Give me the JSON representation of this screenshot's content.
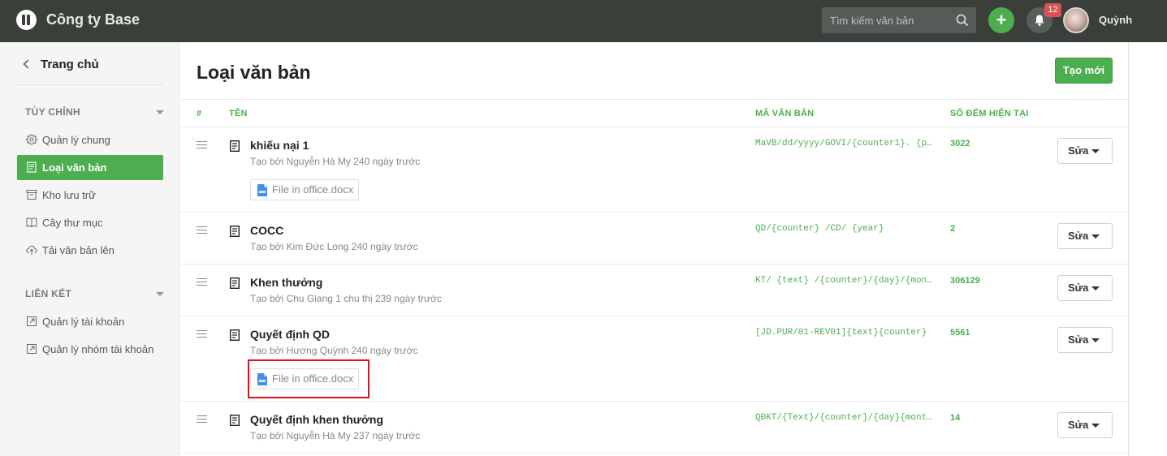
{
  "header": {
    "brand": "Công ty Base",
    "search_placeholder": "Tìm kiếm văn bản",
    "add_label": "+",
    "notification_count": "12",
    "username": "Quỳnh"
  },
  "sidebar": {
    "home": "Trang chủ",
    "sections": [
      {
        "title": "TÙY CHỈNH",
        "items": [
          {
            "label": "Quản lý chung",
            "icon": "gear-icon",
            "active": false
          },
          {
            "label": "Loại văn bản",
            "icon": "document-icon",
            "active": true
          },
          {
            "label": "Kho lưu trữ",
            "icon": "archive-icon",
            "active": false
          },
          {
            "label": "Cây thư mục",
            "icon": "book-icon",
            "active": false
          },
          {
            "label": "Tải văn bản lên",
            "icon": "cloud-upload-icon",
            "active": false
          }
        ]
      },
      {
        "title": "LIÊN KẾT",
        "items": [
          {
            "label": "Quản lý tài khoản",
            "icon": "external-link-icon",
            "active": false
          },
          {
            "label": "Quản lý nhóm tài khoản",
            "icon": "external-link-icon",
            "active": false
          }
        ]
      }
    ]
  },
  "main": {
    "title": "Loại văn bản",
    "create_label": "Tạo mới",
    "columns": [
      "#",
      "TÊN",
      "MÃ VĂN BẢN",
      "SỐ ĐẾM HIỆN TẠI"
    ],
    "edit_label": "Sửa",
    "rows": [
      {
        "name": "khiếu nại 1",
        "created": "Tạo bởi Nguyễn Hà My 240 ngày trước",
        "code": "MaVB/dd/yyyy/GOVI/{counter1}. {p…",
        "count": "3022",
        "file": "File in office.docx"
      },
      {
        "name": "COCC",
        "created": "Tạo bởi Kim Đức Long 240 ngày trước",
        "code": "QD/{counter} /CD/ {year}",
        "count": "2",
        "file": null
      },
      {
        "name": "Khen thưởng",
        "created": "Tạo bởi Chu Giang 1 chu thị 239 ngày trước",
        "code": "KT/ {text} /{counter}/{day}/{mon…",
        "count": "306129",
        "file": null
      },
      {
        "name": "Quyết định QD",
        "created": "Tạo bởi Hương Quỳnh 240 ngày trước",
        "code": "[JD.PUR/01-REV01]{text}{counter}",
        "count": "5561",
        "file": "File in office.docx"
      },
      {
        "name": "Quyết định khen thưởng",
        "created": "Tạo bởi Nguyễn Hà My 237 ngày trước",
        "code": "QĐKT/{Text}/{counter}/{day}{mont…",
        "count": "14",
        "file": null
      }
    ]
  },
  "colors": {
    "accent": "#4cae4f",
    "topbar": "#3a3f3a",
    "highlight": "#d9121b"
  }
}
